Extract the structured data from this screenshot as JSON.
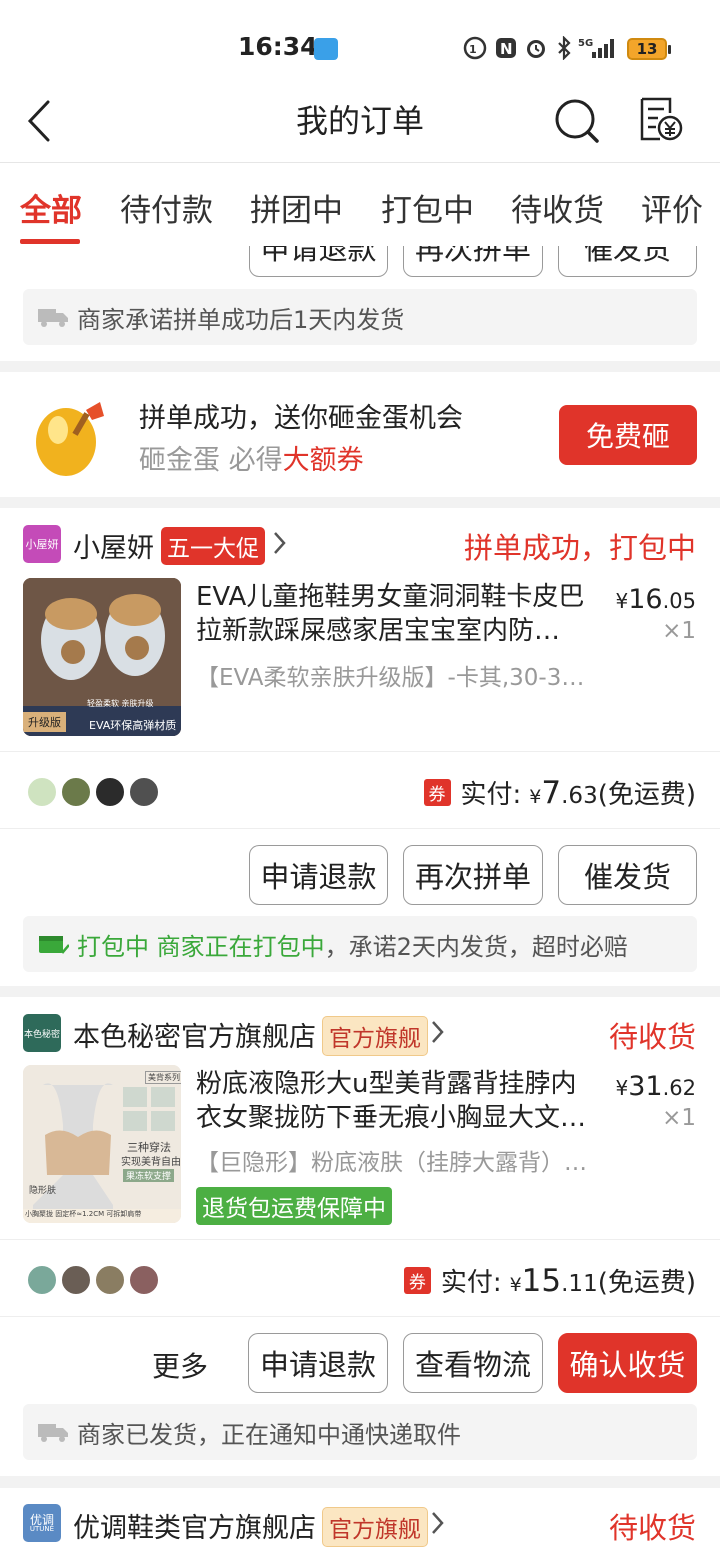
{
  "status_bar": {
    "time": "16:34",
    "battery": "13",
    "network": "5G"
  },
  "header": {
    "title": "我的订单"
  },
  "tabs": [
    "全部",
    "待付款",
    "拼团中",
    "打包中",
    "待收货",
    "评价"
  ],
  "top_partial": {
    "buttons": [
      "申请退款",
      "再次拼单",
      "催发货"
    ],
    "note": "商家承诺拼单成功后1天内发货"
  },
  "promo": {
    "title": "拼单成功，送你砸金蛋机会",
    "subtitle_plain": "砸金蛋 必得",
    "subtitle_red": "大额券",
    "button": "免费砸"
  },
  "orders": [
    {
      "shop_logo_text": "小屋妍",
      "shop_name": "小屋妍",
      "shop_tag": "五一大促",
      "status": "拼单成功，打包中",
      "product_title": "EVA儿童拖鞋男女童洞洞鞋卡皮巴拉新款踩屎感家居宝宝室内防…",
      "spec": "【EVA柔软亲肤升级版】-卡其,30-3…",
      "price_int": "16",
      "price_dec": ".05",
      "qty": "×1",
      "img_tag": "升级版",
      "img_caption": "EVA环保高弹材质",
      "img_sub": "轻盈柔软 亲肤升级",
      "paid_label": "实付:",
      "paid_int": "7",
      "paid_dec": ".63",
      "paid_note": "(免运费)",
      "coupon": "券",
      "buttons": [
        "申请退款",
        "再次拼单",
        "催发货"
      ],
      "note_green": "打包中 商家正在打包中",
      "note_rest": "，承诺2天内发货，超时必赔"
    },
    {
      "shop_logo_text": "本色秘密",
      "shop_name": "本色秘密官方旗舰店",
      "shop_tag": "官方旗舰",
      "status": "待收货",
      "product_title": "粉底液隐形大u型美背露背挂脖内衣女聚拢防下垂无痕小胸显大文…",
      "spec": "【巨隐形】粉底液肤（挂脖大露背）…",
      "guarantee": "退货包运费保障中",
      "price_int": "31",
      "price_dec": ".62",
      "qty": "×1",
      "img_tag1": "美背系列",
      "img_text1": "三种穿法",
      "img_text2": "实现美背自由",
      "img_text3": "果冻软支撑",
      "img_text4": "隐形肤",
      "img_text5": "小胸聚拢  固定杯≈1.2CM  可拆卸肩带",
      "paid_label": "实付:",
      "paid_int": "15",
      "paid_dec": ".11",
      "paid_note": "(免运费)",
      "coupon": "券",
      "more": "更多",
      "buttons": [
        "申请退款",
        "查看物流",
        "确认收货"
      ],
      "note": "商家已发货，正在通知中通快递取件"
    },
    {
      "shop_logo_text": "优调",
      "shop_logo_sub": "UTUNE",
      "shop_name": "优调鞋类官方旗舰店",
      "shop_tag": "官方旗舰",
      "status": "待收货"
    }
  ],
  "currency": "¥",
  "colors": {
    "accent": "#e0342a",
    "green": "#3aa83a",
    "gold_tag_bg": "#fbe6c2"
  }
}
